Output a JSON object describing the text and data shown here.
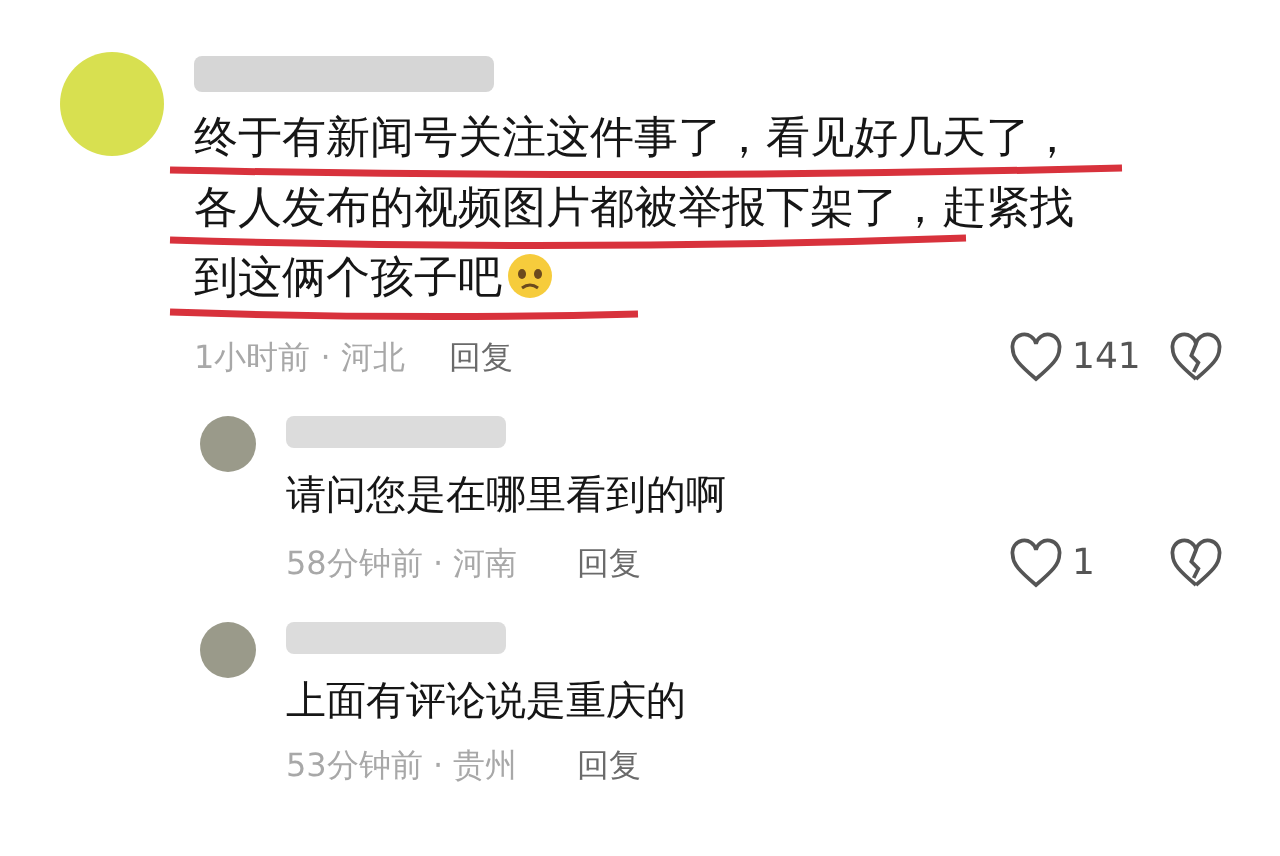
{
  "comments": [
    {
      "text": "终于有新闻号关注这件事了，看见好几天了，各人发布的视频图片都被举报下架了，赶紧找到这俩个孩子吧",
      "emoji": true,
      "underlined": true,
      "meta": "1小时前 · 河北",
      "reply_label": "回复",
      "likes": "141",
      "replies": [
        {
          "text": "请问您是在哪里看到的啊",
          "emoji": false,
          "underlined": false,
          "meta": "58分钟前 · 河南",
          "reply_label": "回复",
          "likes": "1"
        },
        {
          "text": "上面有评论说是重庆的",
          "emoji": false,
          "underlined": false,
          "meta": "53分钟前 · 贵州",
          "reply_label": "回复"
        }
      ]
    }
  ]
}
